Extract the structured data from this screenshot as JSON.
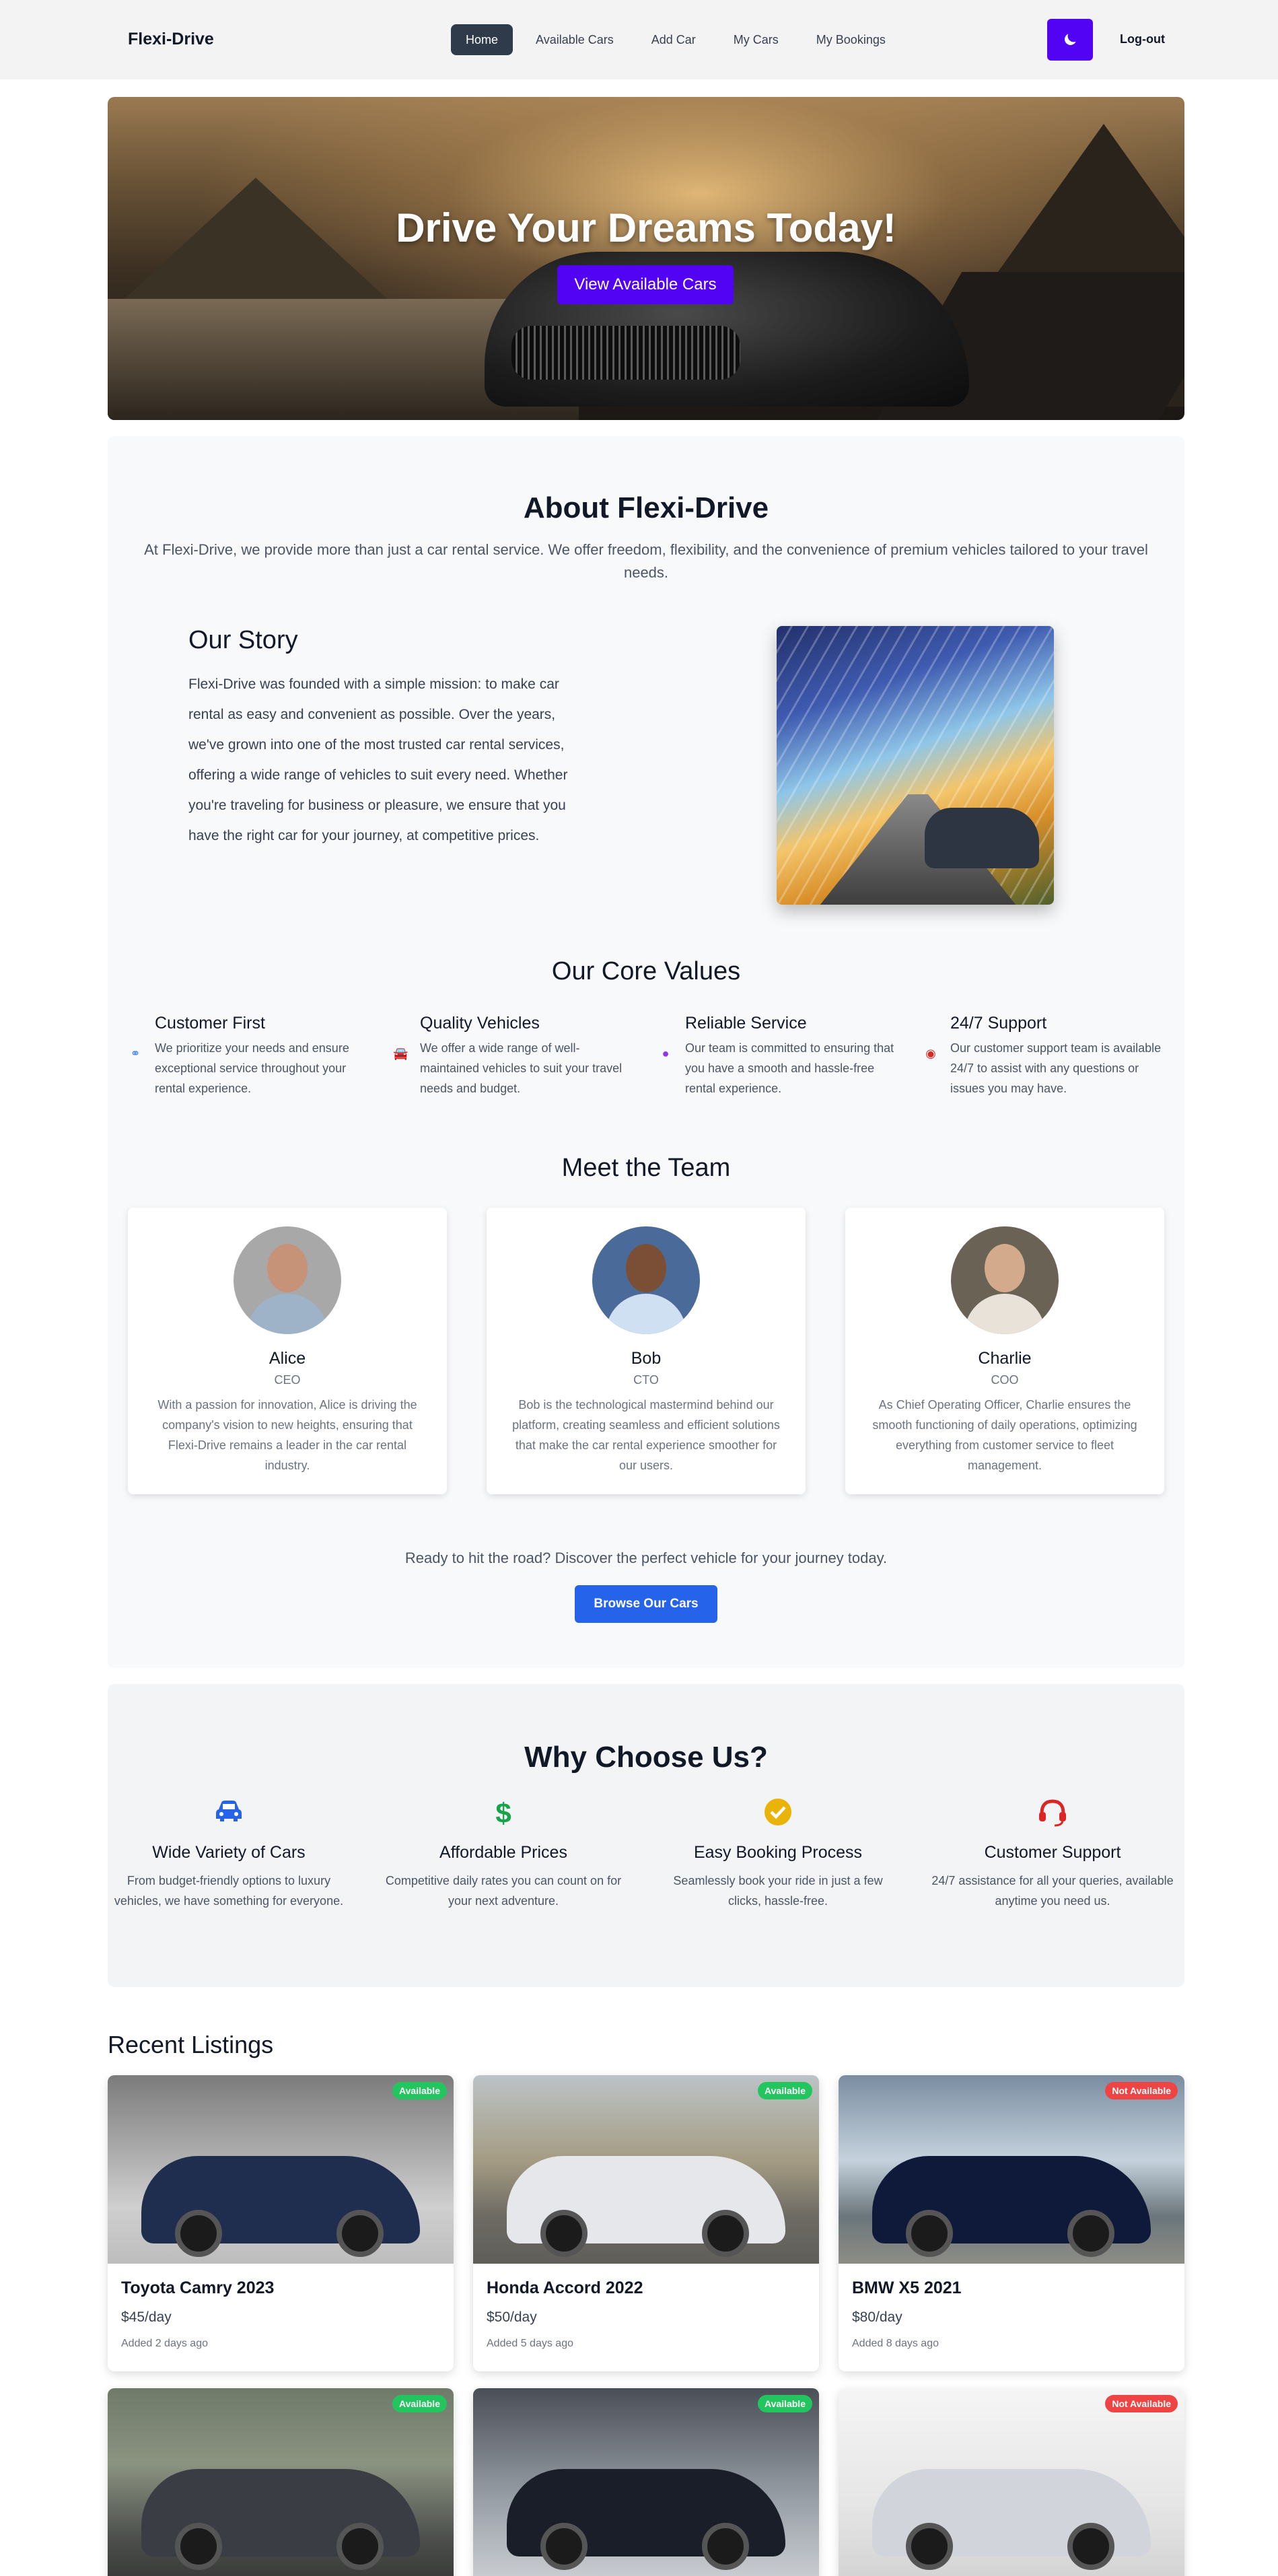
{
  "nav": {
    "brand": "Flexi-Drive",
    "links": [
      "Home",
      "Available Cars",
      "Add Car",
      "My Cars",
      "My Bookings"
    ],
    "logout": "Log-out",
    "accent": "#5203f4"
  },
  "hero": {
    "title": "Drive Your Dreams Today!",
    "button": "View Available Cars"
  },
  "about": {
    "title": "About Flexi-Drive",
    "intro": "At Flexi-Drive, we provide more than just a car rental service. We offer freedom, flexibility, and the convenience of premium vehicles tailored to your travel needs.",
    "story_title": "Our Story",
    "story_text": "Flexi-Drive was founded with a simple mission: to make car rental as easy and convenient as possible. Over the years, we've grown into one of the most trusted car rental services, offering a wide range of vehicles to suit every need. Whether you're traveling for business or pleasure, we ensure that you have the right car for your journey, at competitive prices.",
    "values_title": "Our Core Values",
    "values": [
      {
        "title": "Customer First",
        "desc": "We prioritize your needs and ensure exceptional service throughout your rental experience.",
        "icon": "handshake-icon",
        "color": "#3b82f6"
      },
      {
        "title": "Quality Vehicles",
        "desc": "We offer a wide range of well-maintained vehicles to suit your travel needs and budget.",
        "icon": "car-icon",
        "color": "#16a34a"
      },
      {
        "title": "Reliable Service",
        "desc": "Our team is committed to ensuring that you have a smooth and hassle-free rental experience.",
        "icon": "users-icon",
        "color": "#9333ea"
      },
      {
        "title": "24/7 Support",
        "desc": "Our customer support team is available 24/7 to assist with any questions or issues you may have.",
        "icon": "lifebuoy-icon",
        "color": "#dc2626"
      }
    ],
    "team_title": "Meet the Team",
    "team": [
      {
        "name": "Alice",
        "role": "CEO",
        "desc": "With a passion for innovation, Alice is driving the company's vision to new heights, ensuring that Flexi-Drive remains a leader in the car rental industry."
      },
      {
        "name": "Bob",
        "role": "CTO",
        "desc": "Bob is the technological mastermind behind our platform, creating seamless and efficient solutions that make the car rental experience smoother for our users."
      },
      {
        "name": "Charlie",
        "role": "COO",
        "desc": "As Chief Operating Officer, Charlie ensures the smooth functioning of daily operations, optimizing everything from customer service to fleet management."
      }
    ],
    "cta_text": "Ready to hit the road? Discover the perfect vehicle for your journey today.",
    "cta_button": "Browse Our Cars"
  },
  "why": {
    "title": "Why Choose Us?",
    "items": [
      {
        "title": "Wide Variety of Cars",
        "desc": "From budget-friendly options to luxury vehicles, we have something for everyone.",
        "icon": "car-icon",
        "color": "#2563eb"
      },
      {
        "title": "Affordable Prices",
        "desc": "Competitive daily rates you can count on for your next adventure.",
        "icon": "dollar-icon",
        "color": "#16a34a"
      },
      {
        "title": "Easy Booking Process",
        "desc": "Seamlessly book your ride in just a few clicks, hassle-free.",
        "icon": "check-circle-icon",
        "color": "#eab308"
      },
      {
        "title": "Customer Support",
        "desc": "24/7 assistance for all your queries, available anytime you need us.",
        "icon": "headset-icon",
        "color": "#dc2626"
      }
    ]
  },
  "recent": {
    "title": "Recent Listings",
    "listings": [
      {
        "title": "Toyota Camry 2023",
        "price": "$45/day",
        "added": "Added 2 days ago",
        "status": "Available",
        "car_color": "#1f2d4f"
      },
      {
        "title": "Honda Accord 2022",
        "price": "$50/day",
        "added": "Added 5 days ago",
        "status": "Available",
        "car_color": "#e5e7eb"
      },
      {
        "title": "BMW X5 2021",
        "price": "$80/day",
        "added": "Added 8 days ago",
        "status": "Not Available",
        "car_color": "#0f1a3a"
      },
      {
        "status": "Available",
        "car_color": "#3a3d44"
      },
      {
        "status": "Available",
        "car_color": "#1a1e29"
      },
      {
        "status": "Not Available",
        "car_color": "#d1d5db"
      }
    ],
    "status_colors": {
      "Available": "#22c55e",
      "Not Available": "#ef4444"
    }
  }
}
